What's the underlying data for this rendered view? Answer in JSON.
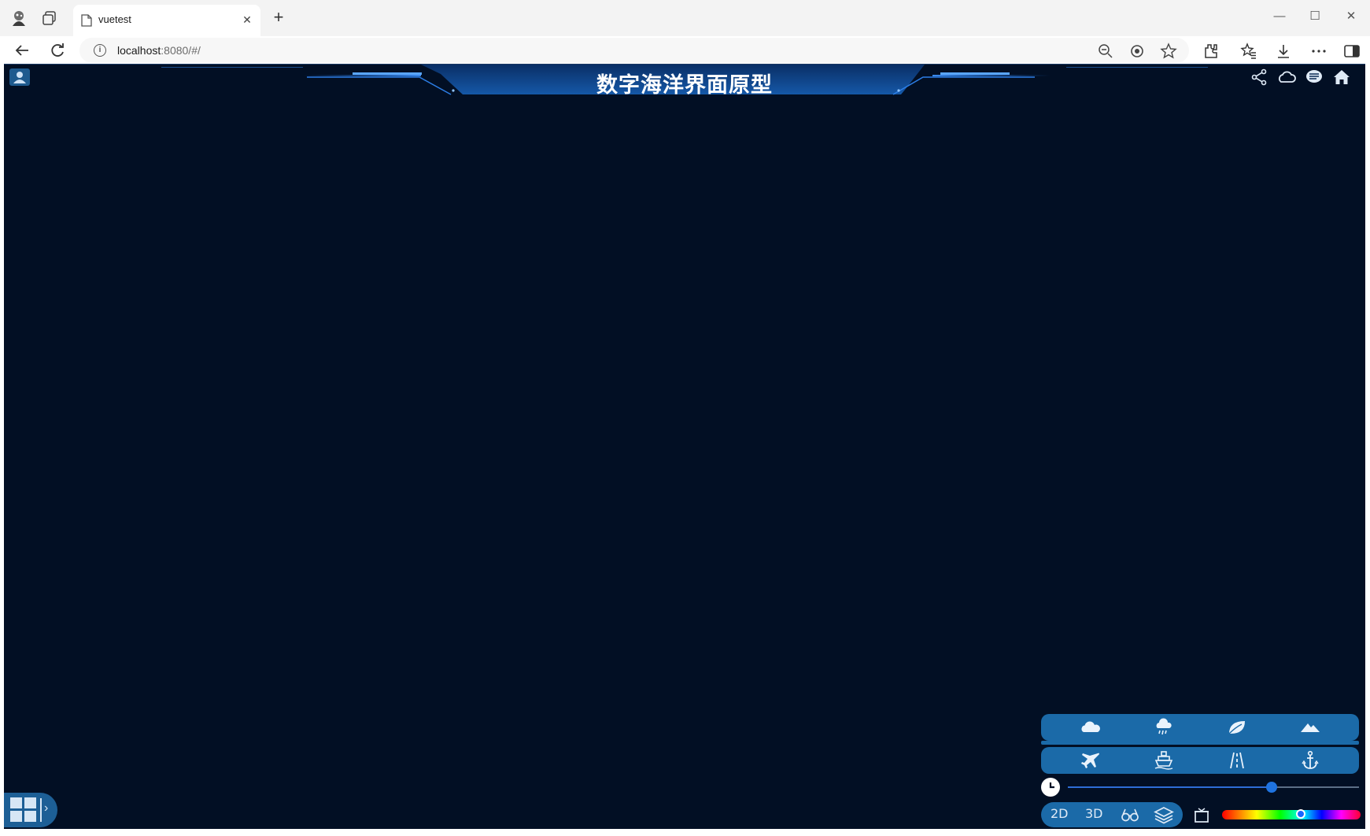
{
  "browser": {
    "tab_title": "vuetest",
    "tab_close": "✕",
    "new_tab": "+",
    "url_host": "localhost",
    "url_rest": ":8080/#/",
    "window_controls": [
      "—",
      "☐",
      "✕"
    ]
  },
  "app": {
    "title": "数字海洋界面原型",
    "header_icons": [
      "share-icon",
      "cloud-icon",
      "chat-icon",
      "home-icon"
    ],
    "panel_row1": [
      "cloud-icon",
      "rain-icon",
      "leaf-icon",
      "mountain-icon"
    ],
    "panel_row2": [
      "airplane-icon",
      "ship-icon",
      "road-icon",
      "anchor-icon"
    ],
    "time_slider_level": 0.7,
    "modes": {
      "mode_2d": "2D",
      "mode_3d": "3D"
    },
    "colorbar_level": 0.57
  }
}
